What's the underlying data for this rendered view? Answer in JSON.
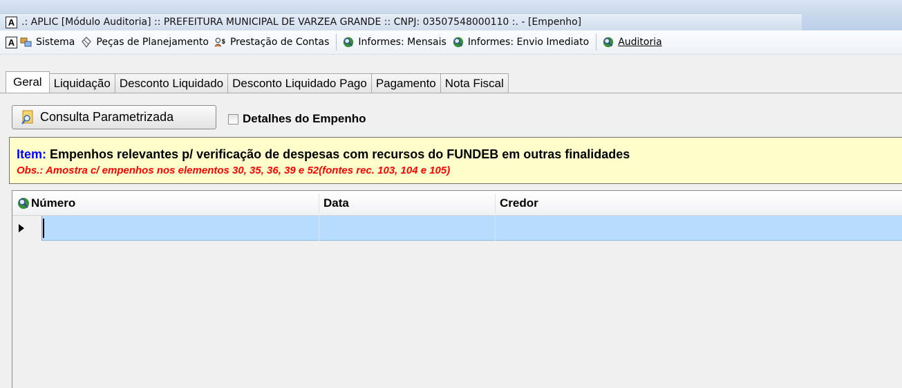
{
  "window": {
    "title": ".: APLIC [Módulo Auditoria] :: PREFEITURA MUNICIPAL DE VARZEA GRANDE :: CNPJ: 03507548000110 :. - [Empenho]",
    "app_icon_letter": "A"
  },
  "menubar": {
    "app_icon_letter": "A",
    "items": [
      {
        "label": "Sistema",
        "icon": "system-icon"
      },
      {
        "label": "Peças de Planejamento",
        "icon": "pieces-icon"
      },
      {
        "label": "Prestação de Contas",
        "icon": "accounts-icon"
      },
      {
        "label": "Informes: Mensais",
        "icon": "magnifier-globe-icon"
      },
      {
        "label": "Informes: Envio Imediato",
        "icon": "magnifier-globe-icon"
      },
      {
        "label": "Auditoria",
        "icon": "magnifier-globe-icon"
      }
    ]
  },
  "tabs": [
    {
      "label": "Geral",
      "active": true
    },
    {
      "label": "Liquidação",
      "active": false
    },
    {
      "label": "Desconto Liquidado",
      "active": false
    },
    {
      "label": "Desconto Liquidado Pago",
      "active": false
    },
    {
      "label": "Pagamento",
      "active": false
    },
    {
      "label": "Nota Fiscal",
      "active": false
    }
  ],
  "toolbar": {
    "consulta_label": "Consulta Parametrizada",
    "detalhes_label": "Detalhes do Empenho",
    "detalhes_checked": false
  },
  "info": {
    "item_prefix": "Item:",
    "item_text": " Empenhos relevantes p/ verificação de despesas com recursos do FUNDEB em outras finalidades",
    "obs_text": "Obs.: Amostra c/ empenhos nos elementos 30, 35, 36, 39 e 52(fontes rec. 103, 104 e 105)"
  },
  "grid": {
    "columns": [
      "Número",
      "Data",
      "Credor"
    ],
    "rows": [
      {
        "numero": "",
        "data": "",
        "credor": "",
        "selected": true
      }
    ]
  },
  "colors": {
    "selected_row": "#b7dcfd",
    "info_background": "#ffffcc",
    "item_prefix": "#0000ff",
    "obs_text": "#ff0000"
  }
}
